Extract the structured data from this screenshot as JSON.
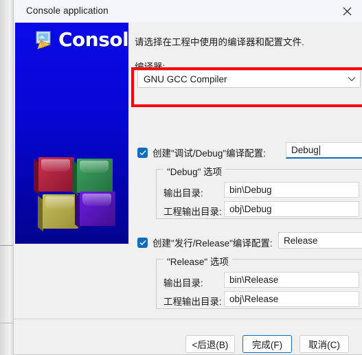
{
  "window": {
    "title": "Console application",
    "close_icon": "close-icon"
  },
  "illustration": {
    "word": "Console",
    "icon": "console-app-icon",
    "cubes_icon": "four-cubes-logo",
    "cube_colors": [
      "#b01a3a",
      "#2f8f4f",
      "#b7ad4a",
      "#5a10c8"
    ],
    "background_color": "#0a0ae8"
  },
  "content": {
    "intro_text": "请选择在工程中使用的编译器和配置文件.",
    "compiler_label": "编译器:",
    "compiler_value": "GNU GCC Compiler",
    "compiler_chevron": "chevron-down-icon",
    "highlight_color": "#ff0000"
  },
  "debug": {
    "checkbox_checked": true,
    "checkbox_label": "创建\"调试/Debug\"编译配置:",
    "name_value": "Debug",
    "group_title": "\"Debug\" 选项",
    "output_dir_label": "输出目录:",
    "output_dir_value": "bin\\Debug",
    "obj_dir_label": "工程输出目录:",
    "obj_dir_value": "obj\\Debug"
  },
  "release": {
    "checkbox_checked": true,
    "checkbox_label": "创建\"发行/Release\"编译配置:",
    "name_value": "Release",
    "group_title": "\"Release\" 选项",
    "output_dir_label": "输出目录:",
    "output_dir_value": "bin\\Release",
    "obj_dir_label": "工程输出目录:",
    "obj_dir_value": "obj\\Release"
  },
  "footer": {
    "back_label": "<后退(B)",
    "finish_label": "完成(F)",
    "cancel_label": "取消(C)",
    "default_button": "完成(F)",
    "accent_color": "#0f6cbd"
  }
}
